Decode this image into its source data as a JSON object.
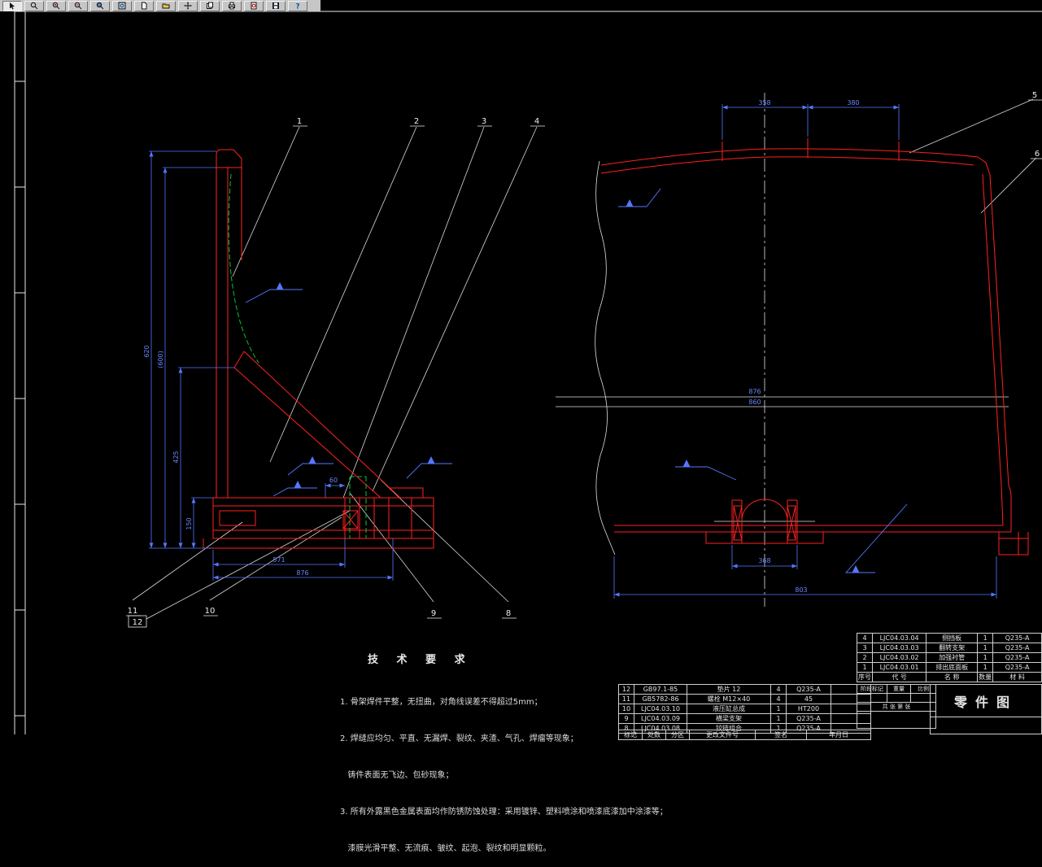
{
  "toolbar": {
    "icons": [
      "select-tool",
      "zoom-realtime",
      "zoom-in",
      "zoom-out",
      "zoom-window",
      "zoom-extents",
      "new-drawing",
      "open-drawing",
      "pan",
      "sheet-set",
      "print",
      "print-preview",
      "save",
      "help"
    ]
  },
  "drawing": {
    "balloons": [
      "1",
      "2",
      "3",
      "4",
      "5",
      "6",
      "8",
      "9",
      "10",
      "11",
      "12"
    ],
    "dims": {
      "left_total": "620",
      "left_span2": "(600)",
      "left_span3": "425",
      "left_base_h": "150",
      "left_small": "60",
      "left_bottom1": "571",
      "left_bottom2": "876",
      "right_top1": "358",
      "right_top2": "380",
      "right_width1": "876",
      "right_width2": "860",
      "right_bracket": "368",
      "right_overall": "803"
    }
  },
  "tech": {
    "title": "技 术 要 求",
    "lines": [
      "1. 骨架焊件平整，无扭曲，对角线误差不得超过5mm；",
      "2. 焊缝应均匀、平直、无漏焊、裂纹、夹渣、气孔、焊瘤等现象；",
      "   铸件表面无飞边、包砂现象；",
      "3. 所有外露黑色金属表面均作防锈防蚀处理：采用镀锌、塑料喷涂和喷漆底漆加中涂漆等；",
      "   漆膜光滑平整、无流痕、皱纹、起泡、裂纹和明显颗粒。"
    ]
  },
  "title_block": {
    "title": "零件图",
    "parts_upper": {
      "rows": [
        {
          "seq": "4",
          "code": "LJC04.03.04",
          "name": "侧挡板",
          "qty": "1",
          "mat": "Q235-A"
        },
        {
          "seq": "3",
          "code": "LJC04.03.03",
          "name": "翻转支架",
          "qty": "1",
          "mat": "Q235-A"
        },
        {
          "seq": "2",
          "code": "LJC04.03.02",
          "name": "加强衬管",
          "qty": "1",
          "mat": "Q235-A"
        },
        {
          "seq": "1",
          "code": "LJC04.03.01",
          "name": "排出底面板",
          "qty": "1",
          "mat": "Q235-A"
        }
      ],
      "header": {
        "seq": "序号",
        "code": "代  号",
        "name": "名  称",
        "qty": "数量",
        "mat": "材  料"
      }
    },
    "parts_lower": {
      "rows": [
        {
          "seq": "12",
          "code": "GB97.1-85",
          "name": "垫片 12",
          "qty": "4",
          "mat": "Q235-A"
        },
        {
          "seq": "11",
          "code": "GB5782-86",
          "name": "螺栓 M12×40",
          "qty": "4",
          "mat": "45"
        },
        {
          "seq": "10",
          "code": "LJC04.03.10",
          "name": "液压缸总成",
          "qty": "1",
          "mat": "HT200"
        },
        {
          "seq": "9",
          "code": "LJC04.03.09",
          "name": "横梁支架",
          "qty": "1",
          "mat": "Q235-A"
        },
        {
          "seq": "8",
          "code": "LJC04.03.08",
          "name": "铰链组合",
          "qty": "1",
          "mat": "Q235-A"
        }
      ]
    },
    "revision": [
      "标记",
      "处数",
      "分区",
      "更改文件号",
      "签名",
      "年月日"
    ],
    "stage": {
      "stage": "阶段标记",
      "weight": "重量",
      "scale": "比例",
      "sheet": "共 张  第 张"
    }
  }
}
